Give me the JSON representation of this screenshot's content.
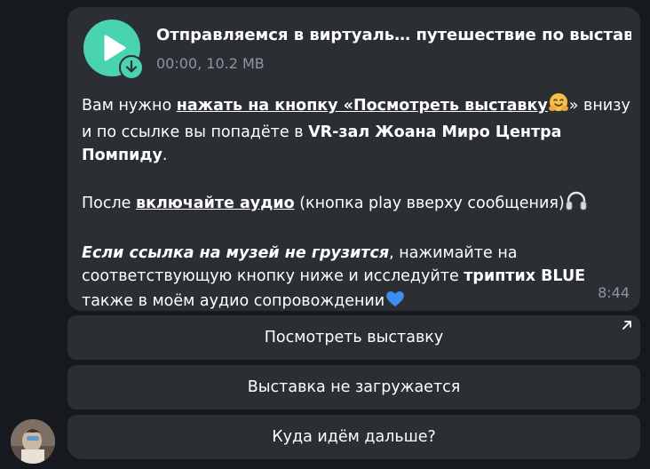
{
  "message": {
    "audio": {
      "title": "Отправляемся в виртуаль… путешествие по выставке",
      "meta": "00:00, 10.2 MB",
      "icon": "play-icon",
      "download_icon": "download-icon",
      "accent": "#4ad3b1"
    },
    "paragraph1": {
      "t1": "Вам нужно ",
      "link": "нажать на кнопку «Посмотреть выставку",
      "t2": "» внизу и по ссылке вы попадёте в ",
      "bold": "VR-зал Жоана Миро Центра Помпиду",
      "t3": "."
    },
    "paragraph2": {
      "t1": "После ",
      "link": "включайте аудио",
      "t2": " (кнопка play вверху сообщения)"
    },
    "paragraph3": {
      "italic": "Если ссылка на музей не грузится",
      "t1": ", нажимайте на соответствующую кнопку ниже и исследуйте ",
      "bold": "триптих BLUE",
      "t2": " также в моём аудио сопровождении"
    },
    "time": "8:44",
    "background": "#2b2f33"
  },
  "keyboard": {
    "buttons": [
      {
        "label": "Посмотреть выставку",
        "icon": "external-link-icon"
      },
      {
        "label": "Выставка не загружается"
      },
      {
        "label": "Куда идём дальше?"
      }
    ]
  },
  "chat_background": "#161a1f"
}
